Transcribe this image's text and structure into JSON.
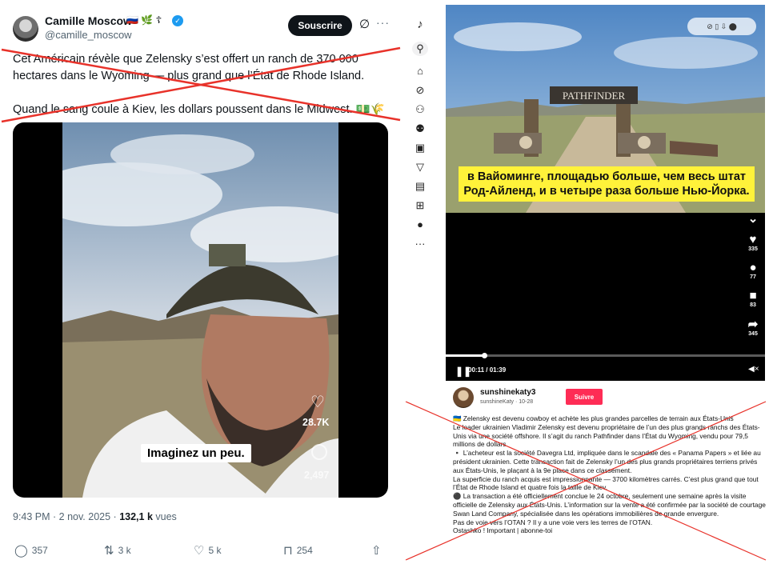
{
  "tweet": {
    "display_name": "Camille Moscow",
    "name_emojis": "🇷🇺 🌿 ☦",
    "handle": "@camille_moscow",
    "subscribe_label": "Souscrire",
    "text_para1": "Cet Américain révèle que Zelensky s’est offert un ranch de 370 000 hectares dans le Wyoming — plus grand que l’État de Rhode Island.",
    "text_para2": "Quand le sang coule à Kiev, les dollars poussent dans le Midwest. 💵🌾",
    "video": {
      "caption": "Imaginez un peu.",
      "likes": "28.7K",
      "comments": "2,497"
    },
    "timestamp": "9:43 PM · 2 nov. 2025 · ",
    "views_count": "132,1 k",
    "views_label": " vues",
    "replies": "357",
    "reposts": "3 k",
    "likes": "5 k",
    "bookmarks": "254",
    "colors": {
      "accent": "#1d9bf0",
      "strike": "#e8322a"
    }
  },
  "tiktok": {
    "sidebar_icons": [
      "tiktok-logo-icon",
      "search-icon",
      "home-icon",
      "explore-icon",
      "following-icon",
      "friends-icon",
      "live-icon",
      "messages-icon",
      "activity-icon",
      "upload-icon",
      "profile-icon",
      "more-icon"
    ],
    "messages_badge": "",
    "video": {
      "sign_text": "PATHFINDER",
      "caption_ru": "в Вайоминге, площадью больше, чем весь штат Род-Айленд, и в четыре раза больше Нью-Йорка.",
      "likes": "335",
      "comments": "77",
      "bookmarks": "83",
      "shares": "345",
      "time": "00:11 / 01:39",
      "progress": 0.12
    },
    "username": "sunshinekaty3",
    "subline": "sunshineKaty · 10-28",
    "follow_label": "Suivre",
    "description": [
      "🇺🇦 Zelensky est devenu cowboy et achète les plus grandes parcelles de terrain aux États-Unis",
      "Le leader ukrainien Vladimir Zelensky est devenu propriétaire de l’un des plus grands ranchs des États-Unis via une société offshore. Il s’agit du ranch Pathfinder dans l’État du Wyoming, vendu pour 79,5 millions de dollars.",
      "▪️ L’acheteur est la société Davegra Ltd, impliquée dans le scandale des « Panama Papers » et liée au président ukrainien. Cette transaction fait de Zelensky l’un des plus grands propriétaires terriens privés aux États-Unis, le plaçant à la 9e place dans ce classement.",
      "La superficie du ranch acquis est impressionnante — 3700 kilomètres carrés. C’est plus grand que tout l’État de Rhode Island et quatre fois la taille de Kiev.",
      "⚫ La transaction a été officiellement conclue le 24 octobre, seulement une semaine après la visite officielle de Zelensky aux États-Unis. L’information sur la vente a été confirmée par la société de courtage Swan Land Company, spécialisée dans les opérations immobilières de grande envergure.",
      "Pas de voie vers l’OTAN ? Il y a une voie vers les terres de l’OTAN.",
      "Ostashko ! Important | abonne-toi"
    ]
  }
}
